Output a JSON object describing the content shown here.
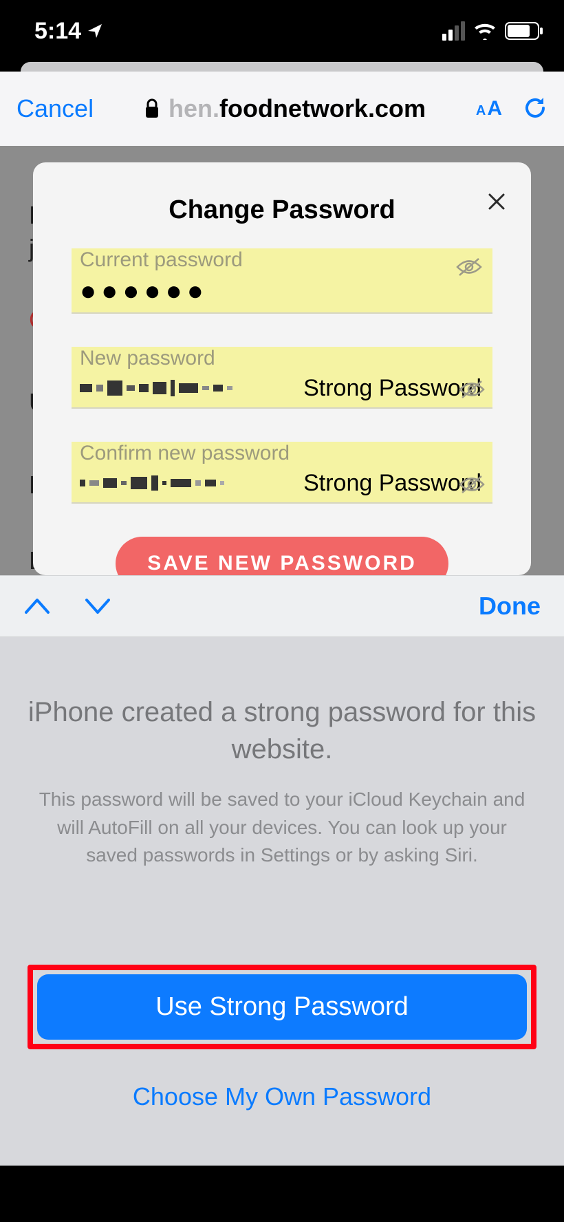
{
  "status": {
    "time": "5:14",
    "location_arrow": "➤",
    "signal_active_bars": 2,
    "signal_total_bars": 4,
    "battery_percent_visual": 70
  },
  "safari": {
    "cancel": "Cancel",
    "url_faded_prefix": "hen.",
    "url_main": "foodnetwork.com",
    "aa_label": "aA"
  },
  "modal": {
    "title": "Change Password",
    "current_label": "Current password",
    "current_value_masked": "●●●●●●",
    "new_label": "New password",
    "new_suffix": "Strong Password",
    "confirm_label": "Confirm new password",
    "confirm_suffix": "Strong Password",
    "save_button": "SAVE NEW PASSWORD"
  },
  "assistant": {
    "done": "Done"
  },
  "keychain": {
    "heading": "iPhone created a strong password for this website.",
    "body": "This password will be saved to your iCloud Keychain and will AutoFill on all your devices. You can look up your saved passwords in Settings or by asking Siri.",
    "primary": "Use Strong Password",
    "secondary": "Choose My Own Password"
  }
}
